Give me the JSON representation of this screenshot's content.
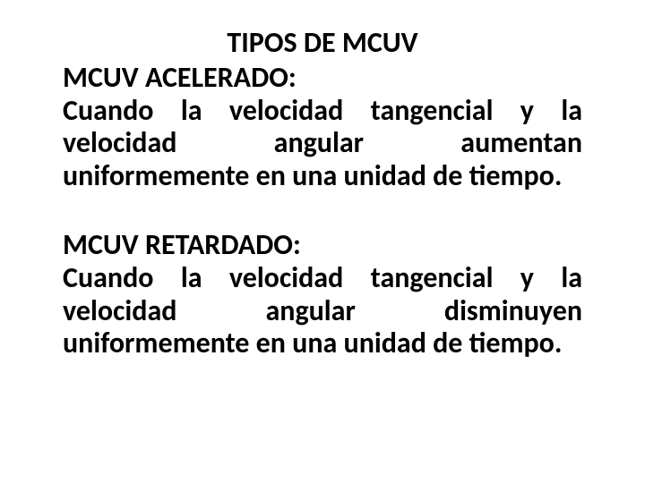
{
  "title": "TIPOS DE MCUV",
  "section1": {
    "heading": "MCUV ACELERADO:",
    "body": "Cuando la velocidad tangencial y la velocidad angular aumentan uniformemente en una unidad de tiempo."
  },
  "section2": {
    "heading": "MCUV RETARDADO:",
    "body": "Cuando la velocidad tangencial y la velocidad angular disminuyen uniformemente en una unidad de tiempo."
  }
}
